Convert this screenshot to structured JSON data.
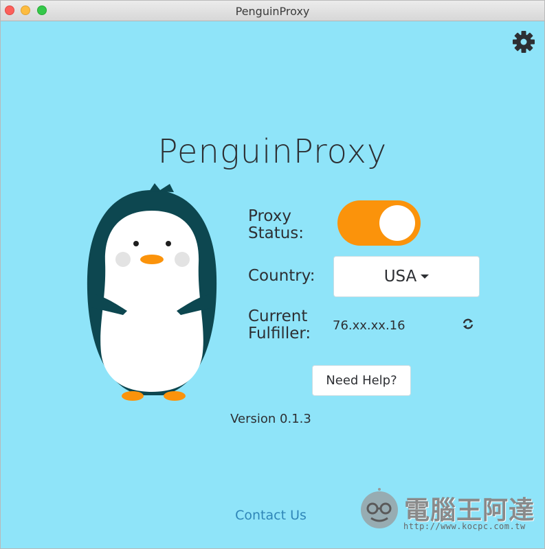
{
  "window": {
    "title": "PenguinProxy"
  },
  "app": {
    "title": "PenguinProxy"
  },
  "settings": {
    "icon": "gear-icon"
  },
  "proxy": {
    "label": "Proxy Status:",
    "enabled": true,
    "toggle_color": "#fb930b"
  },
  "country": {
    "label": "Country:",
    "selected": "USA",
    "icon": "caret-down-icon"
  },
  "fulfiller": {
    "label": "Current Fulfiller:",
    "value": "76.xx.xx.16",
    "refresh_icon": "refresh-icon"
  },
  "help": {
    "label": "Need Help?"
  },
  "version": {
    "text": "Version 0.1.3"
  },
  "contact": {
    "label": "Contact Us",
    "color": "#2f86b8"
  },
  "watermark": {
    "title": "電腦王阿達",
    "url": "http://www.kocpc.com.tw"
  },
  "colors": {
    "background": "#8fe4f9",
    "text": "#2d2f33",
    "penguin_body": "#0d4750"
  }
}
